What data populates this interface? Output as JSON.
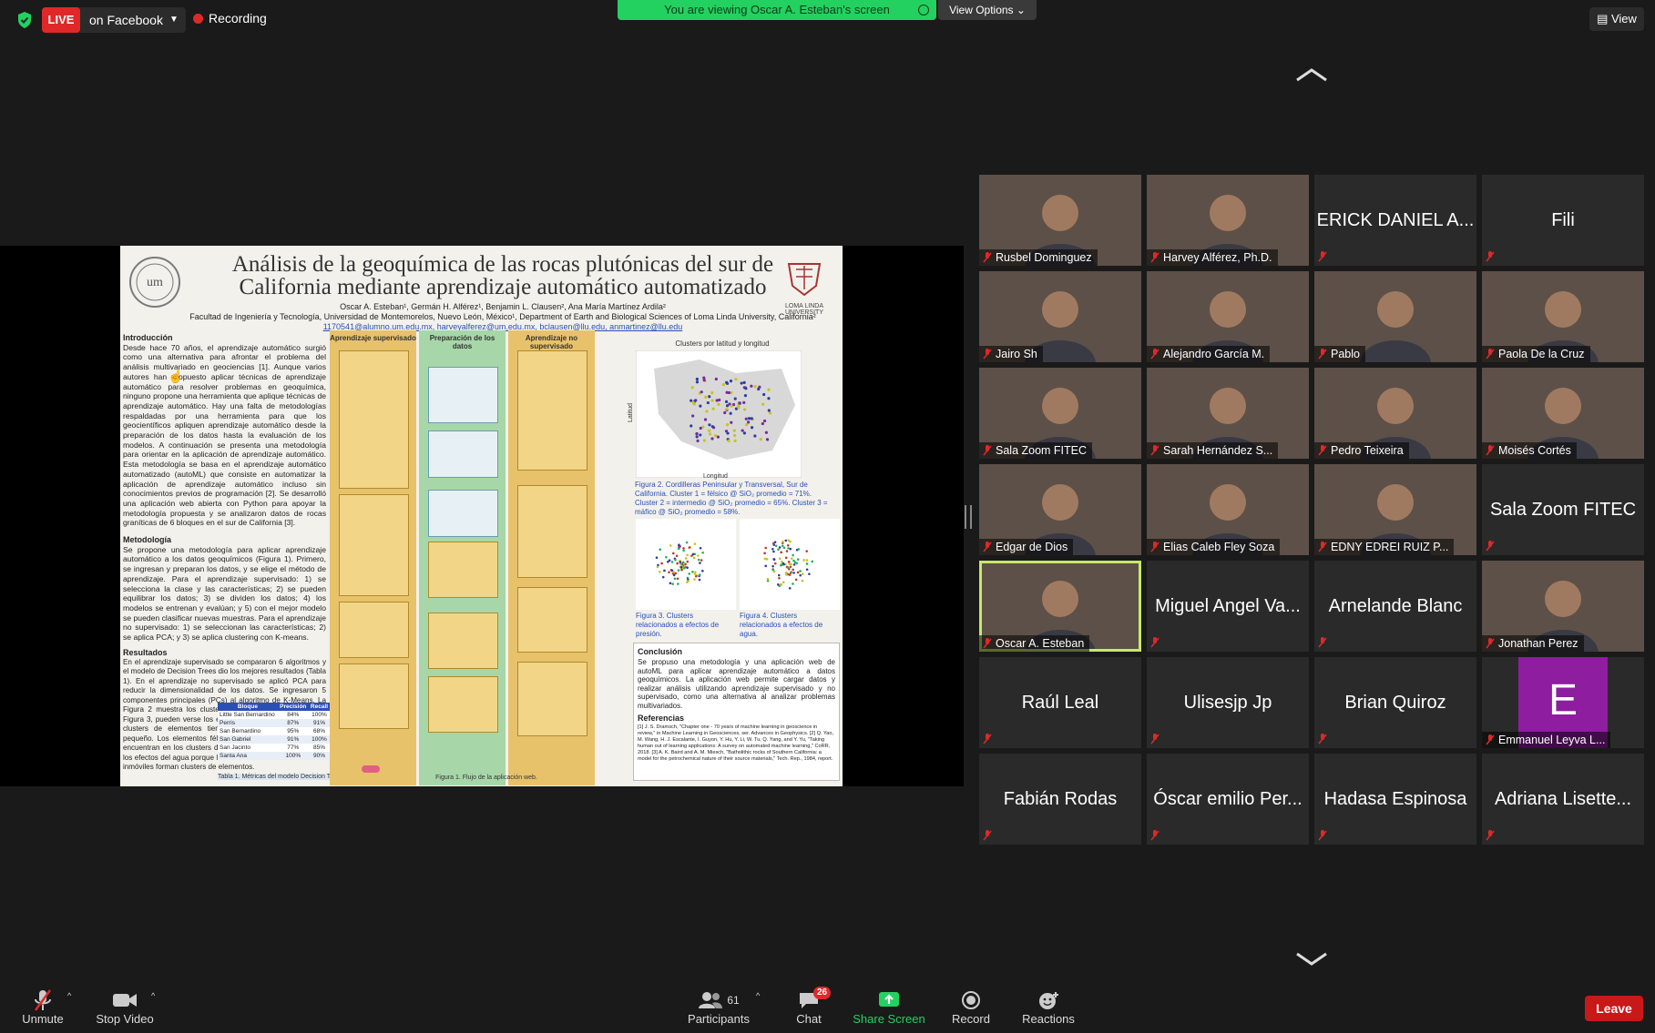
{
  "topbar": {
    "live_tag": "LIVE",
    "live_destination": "on Facebook",
    "recording_label": "Recording",
    "viewing_banner": "You are viewing Oscar A. Esteban's screen",
    "view_options_label": "View Options ⌄",
    "view_button_label": "View"
  },
  "poster": {
    "title_line1": "Análisis de la geoquímica de las rocas plutónicas del sur de",
    "title_line2": "California mediante aprendizaje automático automatizado",
    "authors": "Oscar A. Esteban¹, Germán H. Alférez¹, Benjamin L. Clausen², Ana María Martínez Ardila²",
    "affiliations": "Facultad de Ingeniería y Tecnología, Universidad de Montemorelos, Nuevo León, México¹, Department of Earth and Biological Sciences of Loma Linda University, California²",
    "emails": "1170541@alumno.um.edu.mx, harveyalferez@um.edu.mx, bclausen@llu.edu, anmartinez@llu.edu",
    "right_logo_text": "LOMA LINDA UNIVERSITY",
    "intro_heading": "Introducción",
    "intro_text": "Desde hace 70 años, el aprendizaje automático surgió como una alternativa para afrontar el problema del análisis multivariado en geociencias [1]. Aunque varios autores han propuesto aplicar técnicas de aprendizaje automático para resolver problemas en geoquímica, ninguno propone una herramienta que aplique técnicas de aprendizaje automático. Hay una falta de metodologías respaldadas por una herramienta para que los geocientíficos apliquen aprendizaje automático desde la preparación de los datos hasta la evaluación de los modelos. A continuación se presenta una metodología para orientar en la aplicación de aprendizaje automático. Esta metodología se basa en el aprendizaje automático automatizado (autoML) que consiste en automatizar la aplicación de aprendizaje automático incluso sin conocimientos previos de programación [2]. Se desarrolló una aplicación web abierta con Python para apoyar la metodología propuesta y se analizaron datos de rocas graníticas de 6 bloques en el sur de California [3].",
    "method_heading": "Metodología",
    "method_text": "Se propone una metodología para aplicar aprendizaje automático a los datos geoquímicos (Figura 1). Primero, se ingresan y preparan los datos, y se elige el método de aprendizaje. Para el aprendizaje supervisado: 1) se selecciona la clase y las características; 2) se pueden equilibrar los datos; 3) se dividen los datos; 4) los modelos se entrenan y evalúan; y 5) con el mejor modelo se pueden clasificar nuevas muestras. Para el aprendizaje no supervisado: 1) se seleccionan las características; 2) se aplica PCA; y 3) se aplica clustering con K-means.",
    "results_heading": "Resultados",
    "results_text": "En el aprendizaje supervisado se compararon 6 algoritmos y el modelo de Decision Trees dio los mejores resultados (Tabla 1). En el aprendizaje no supervisado se aplicó PCA para reducir la dimensionalidad de los datos. Se ingresaron 5 componentes principales (PCs) al algoritmo de K-Means. La Figura 2 muestra los clusters por longitud y latitud. En la Figura 3, pueden verse los efectos de la presión, ya que los clusters de elementos tienen un radio iónico grande y pequeño. Los elementos félsicos, máficos e intermedios se encuentran en los clusters de muestras. La Figura 4 sugiere los efectos del agua porque los elementos alcalinos móviles e inmóviles forman clusters de elementos.",
    "table_header": [
      "Bloque",
      "Precisión",
      "Recall",
      "F-Score"
    ],
    "table_rows": [
      [
        "Little San Bernardino",
        "84%",
        "100%",
        "91%"
      ],
      [
        "Perris",
        "87%",
        "91%",
        "89%"
      ],
      [
        "San Bernardino",
        "95%",
        "68%",
        "79%"
      ],
      [
        "San Gabriel",
        "91%",
        "100%",
        "95%"
      ],
      [
        "San Jacinto",
        "77%",
        "85%",
        "81%"
      ],
      [
        "Santa Ana",
        "100%",
        "90%",
        "95%"
      ]
    ],
    "table_caption": "Tabla 1. Métricas del modelo Decision Trees.",
    "col_supervised": "Aprendizaje supervisado",
    "col_prep": "Preparación de los datos",
    "col_unsupervised": "Aprendizaje no supervisado",
    "flow_caption": "Figura 1. Flujo de la aplicación web.",
    "map_title": "Clusters por latitud y longitud",
    "map_xlabel": "Longitud",
    "map_ylabel": "Latitud",
    "fig2_caption": "Figura 2. Cordilleras Peninsular y Transversal, Sur de California. Cluster 1 = félsico @ SiO₂ promedio = 71%. Cluster 2 = intermedio @ SiO₂ promedio = 65%. Cluster 3 = máfico @ SiO₂ promedio = 58%.",
    "fig3_caption": "Figura 3. Clusters relacionados a efectos de presión.",
    "fig4_caption": "Figura 4. Clusters relacionados a efectos de agua.",
    "conclusion_heading": "Conclusión",
    "conclusion_text": "Se propuso una metodología y una aplicación web de autoML para aplicar aprendizaje automático a datos geoquímicos. La aplicación web permite cargar datos y realizar análisis utilizando aprendizaje supervisado y no supervisado, como una alternativa al analizar problemas multivariados.",
    "refs_heading": "Referencias",
    "refs_text": "[1] J. S. Dramsch, \"Chapter one - 70 years of machine learning in geoscience in review,\" in Machine Learning in Geosciences, ser. Advances in Geophysics. [2] Q. Yao, M. Wang, H. J. Escalante, I. Guyon, Y. Hu, Y. Li, W. Tu, Q. Yang, and Y. Yu, \"Taking human out of learning applications: A survey on automated machine learning,\" CoRR, 2018. [3] A. K. Baird and A. M. Miesch, \"Batholithic rocks of Southern California: a model for the petrochemical nature of their source materials,\" Tech. Rep., 1984, report."
  },
  "participants_tiles": [
    {
      "name": "Rusbel Dominguez",
      "video": true,
      "active": false
    },
    {
      "name": "Harvey Alférez, Ph.D.",
      "video": true,
      "active": false
    },
    {
      "name": "ERICK DANIEL A...",
      "video": false,
      "active": false
    },
    {
      "name": "Fili",
      "video": false,
      "active": false
    },
    {
      "name": "Jairo Sh",
      "video": true,
      "active": false
    },
    {
      "name": "Alejandro García M.",
      "video": true,
      "active": false
    },
    {
      "name": "Pablo",
      "video": true,
      "active": false
    },
    {
      "name": "Paola De la Cruz",
      "video": true,
      "active": false
    },
    {
      "name": "Sala Zoom FITEC",
      "video": true,
      "active": false
    },
    {
      "name": "Sarah Hernández S...",
      "video": true,
      "active": false
    },
    {
      "name": "Pedro Teixeira",
      "video": true,
      "active": false
    },
    {
      "name": "Moisés Cortés",
      "video": true,
      "active": false
    },
    {
      "name": "Edgar de Dios",
      "video": true,
      "active": false
    },
    {
      "name": "Elias Caleb Fley Soza",
      "video": true,
      "active": false
    },
    {
      "name": "EDNY EDREI RUIZ P...",
      "video": true,
      "active": false
    },
    {
      "name": "Sala Zoom FITEC",
      "video": false,
      "active": false
    },
    {
      "name": "Oscar A. Esteban",
      "video": true,
      "active": true
    },
    {
      "name": "Miguel Angel Va...",
      "video": false,
      "active": false
    },
    {
      "name": "Arnelande Blanc",
      "video": false,
      "active": false
    },
    {
      "name": "Jonathan Perez",
      "video": true,
      "active": false
    },
    {
      "name": "Raúl Leal",
      "video": false,
      "active": false
    },
    {
      "name": "Ulisesjp Jp",
      "video": false,
      "active": false
    },
    {
      "name": "Brian Quiroz",
      "video": false,
      "active": false
    },
    {
      "name": "Emmanuel Leyva L...",
      "video": false,
      "active": false,
      "avatar_letter": "E"
    },
    {
      "name": "Fabián Rodas",
      "video": false,
      "active": false
    },
    {
      "name": "Óscar emilio Per...",
      "video": false,
      "active": false
    },
    {
      "name": "Hadasa Espinosa",
      "video": false,
      "active": false
    },
    {
      "name": "Adriana Lisette...",
      "video": false,
      "active": false
    }
  ],
  "toolbar": {
    "unmute_label": "Unmute",
    "stop_video_label": "Stop Video",
    "participants_label": "Participants",
    "participants_count": "61",
    "chat_label": "Chat",
    "chat_badge": "26",
    "share_screen_label": "Share Screen",
    "record_label": "Record",
    "reactions_label": "Reactions",
    "leave_label": "Leave"
  },
  "colors": {
    "live_red": "#e02828",
    "banner_green": "#23d160",
    "share_green": "#23d160",
    "active_speaker": "#c7e86b",
    "leave_red": "#c81818"
  },
  "icons": [
    "shield-check-icon",
    "mic-muted-icon",
    "video-camera-icon",
    "participants-icon",
    "chat-icon",
    "share-screen-icon",
    "record-icon",
    "reactions-icon",
    "chevron-up-icon",
    "chevron-down-icon"
  ]
}
